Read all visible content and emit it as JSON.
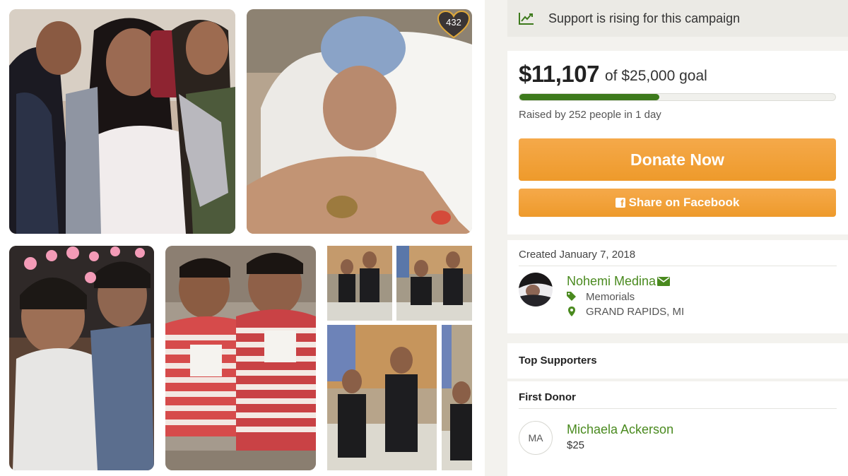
{
  "gallery": {
    "heart_count": "432"
  },
  "campaign": {
    "rising_text": "Support is rising for this campaign",
    "amount_raised": "$11,107",
    "goal_text": "of $25,000 goal",
    "progress_fraction": 0.444,
    "raised_by_text": "Raised by 252 people in 1 day",
    "donate_label": "Donate Now",
    "share_label": "Share on Facebook",
    "accent_color": "#ef9d33",
    "progress_color": "#3d7a1c"
  },
  "organizer": {
    "created_text": "Created January 7, 2018",
    "name": "Nohemi Medina",
    "category": "Memorials",
    "location": "GRAND RAPIDS, MI"
  },
  "supporters": {
    "top_supporters_label": "Top Supporters",
    "first_donor_label": "First Donor",
    "donor_initials": "MA",
    "donor_name": "Michaela Ackerson",
    "donor_amount": "$25"
  }
}
